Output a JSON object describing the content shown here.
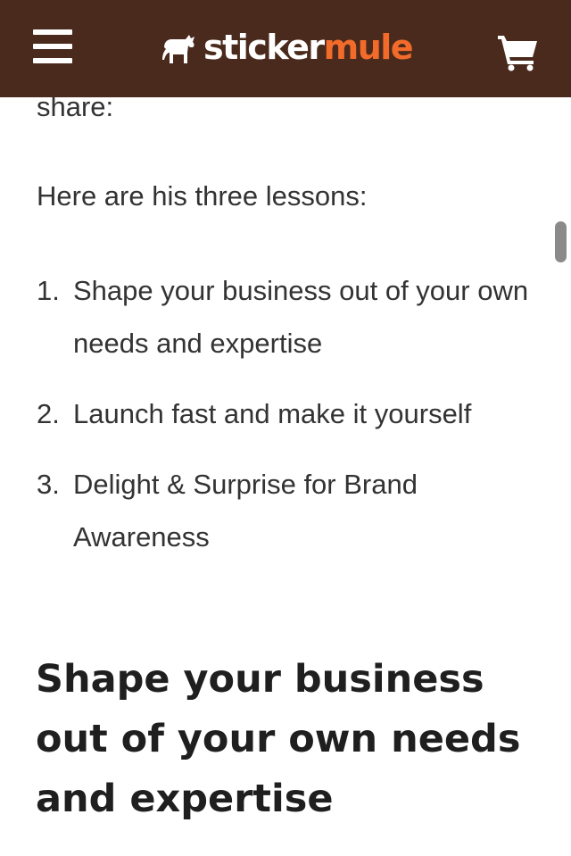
{
  "header": {
    "logo_primary": "sticker",
    "logo_accent": "mule",
    "brand_bg_color": "#4a2a1c",
    "brand_accent_color": "#f26b2a",
    "menu_icon": "hamburger-menu-icon",
    "cart_icon": "shopping-cart-icon"
  },
  "article": {
    "partial_text": "share:",
    "intro": "Here are his three lessons:",
    "lessons": [
      {
        "number": "1.",
        "text": "Shape your business out of your own needs and expertise"
      },
      {
        "number": "2.",
        "text": "Launch fast and make it yourself"
      },
      {
        "number": "3.",
        "text": "Delight & Surprise for Brand Awareness"
      }
    ],
    "section_heading": "Shape your business out of your own needs and expertise"
  }
}
